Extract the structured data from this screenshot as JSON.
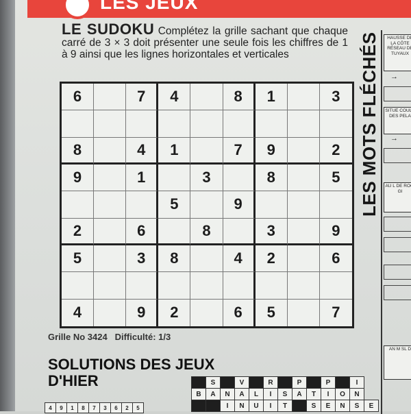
{
  "header": {
    "section_title": "LES JEUX"
  },
  "sudoku": {
    "title": "LE SUDOKU",
    "instructions": "Complétez la grille sachant que chaque carré de 3 × 3 doit présenter une seule fois les chiffres de 1 à 9 ainsi que les lignes horizontales et verticales",
    "grid": [
      [
        "6",
        "",
        "7",
        "4",
        "",
        "8",
        "1",
        "",
        "3"
      ],
      [
        "",
        "",
        "",
        "",
        "",
        "",
        "",
        "",
        ""
      ],
      [
        "8",
        "",
        "4",
        "1",
        "",
        "7",
        "9",
        "",
        "2"
      ],
      [
        "9",
        "",
        "1",
        "",
        "3",
        "",
        "8",
        "",
        "5"
      ],
      [
        "",
        "",
        "",
        "5",
        "",
        "9",
        "",
        "",
        ""
      ],
      [
        "2",
        "",
        "6",
        "",
        "8",
        "",
        "3",
        "",
        "9"
      ],
      [
        "5",
        "",
        "3",
        "8",
        "",
        "4",
        "2",
        "",
        "6"
      ],
      [
        "",
        "",
        "",
        "",
        "",
        "",
        "",
        "",
        ""
      ],
      [
        "4",
        "",
        "9",
        "2",
        "",
        "6",
        "5",
        "",
        "7"
      ]
    ],
    "grid_number": "Grille No 3424",
    "difficulty": "Difficulté: 1/3"
  },
  "mots_fleches": {
    "title": "LES MOTS FLÉCHÉS",
    "clues": [
      "HAUSSE DE LA CÔTE RÉSEAU DE TUYAUX",
      "SITUE COULE DES PELA",
      "AU L DE ROCI GI",
      "AN M SL D"
    ]
  },
  "solutions": {
    "title_line1": "SOLUTIONS  DES JEUX",
    "title_line2": "D'HIER",
    "grid_rows": [
      [
        "#",
        "S",
        "#",
        "V",
        "#",
        "R",
        "#",
        "P",
        "#",
        "P",
        "#",
        "I"
      ],
      [
        "B",
        "A",
        "N",
        "A",
        "L",
        "I",
        "S",
        "A",
        "T",
        "I",
        "O",
        "N"
      ],
      [
        "#",
        "#",
        "I",
        "N",
        "U",
        "I",
        "T",
        "#",
        "S",
        "E",
        "N",
        "S",
        "E"
      ]
    ],
    "bottom_strip": [
      "4",
      "9",
      "1",
      "8",
      "7",
      "3",
      "6",
      "2",
      "5"
    ]
  }
}
